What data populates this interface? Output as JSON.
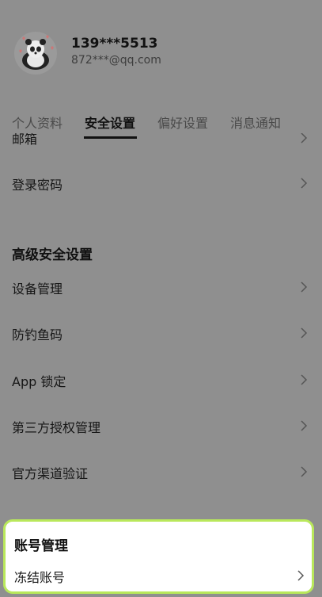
{
  "profile": {
    "phone": "139***5513",
    "email": "872***@qq.com"
  },
  "tabs": [
    {
      "label": "个人资料"
    },
    {
      "label": "安全设置"
    },
    {
      "label": "偏好设置"
    },
    {
      "label": "消息通知"
    }
  ],
  "active_tab": "安全设置",
  "partial_item": {
    "label": "邮箱"
  },
  "basic_items": [
    {
      "label": "登录密码"
    }
  ],
  "advanced_section": {
    "title": "高级安全设置",
    "items": [
      {
        "label": "设备管理"
      },
      {
        "label": "防钓鱼码"
      },
      {
        "label": "App 锁定"
      },
      {
        "label": "第三方授权管理"
      },
      {
        "label": "官方渠道验证"
      }
    ]
  },
  "account_section": {
    "title": "账号管理",
    "items": [
      {
        "label": "冻结账号"
      }
    ]
  },
  "colors": {
    "overlay_background": "#8f8f8f",
    "highlight_border": "#b9e85b",
    "card_background": "#ffffff"
  }
}
